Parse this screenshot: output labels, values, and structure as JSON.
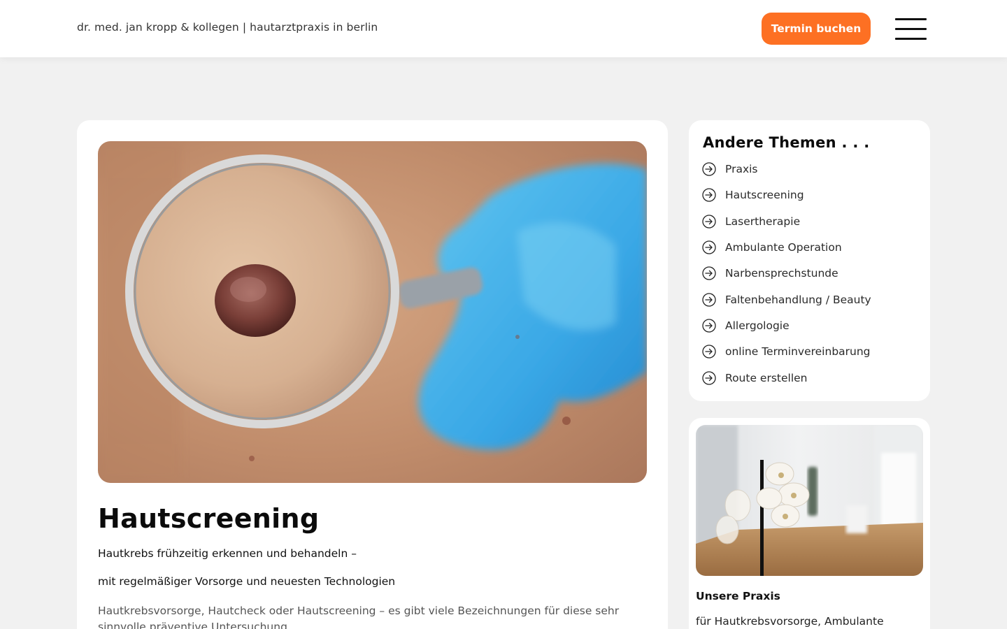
{
  "header": {
    "brand": "dr. med. jan kropp & kollegen | hautarztpraxis in berlin",
    "cta_label": "Termin buchen",
    "menu_icon": "hamburger-menu-icon"
  },
  "colors": {
    "accent": "#fd7023",
    "page_background": "#f1f1f1",
    "card_background": "#ffffff"
  },
  "article": {
    "image_subject": "magnifying-glass-over-mole",
    "title": "Hautscreening",
    "subtitle_line1": "Hautkrebs frühzeitig erkennen und behandeln –",
    "subtitle_line2": "mit regelmäßiger Vorsorge und neuesten Technologien",
    "body": "Hautkrebsvorsorge, Hautcheck oder Hautscreening – es gibt viele Bezeichnungen für diese sehr sinnvolle präventive Untersuchung."
  },
  "sidebar": {
    "title": "Andere Themen . . .",
    "item_icon": "arrow-circle-right-icon",
    "items": [
      {
        "label": "Praxis"
      },
      {
        "label": "Hautscreening"
      },
      {
        "label": "Lasertherapie"
      },
      {
        "label": "Ambulante Operation"
      },
      {
        "label": "Narbensprechstunde"
      },
      {
        "label": "Faltenbehandlung / Beauty"
      },
      {
        "label": "Allergologie"
      },
      {
        "label": "online Terminvereinbarung"
      },
      {
        "label": "Route erstellen"
      }
    ]
  },
  "praxis_card": {
    "image_subject": "white-orchid-in-practice-room",
    "title": "Unsere Praxis",
    "text": "für Hautkrebsvorsorge, Ambulante"
  }
}
